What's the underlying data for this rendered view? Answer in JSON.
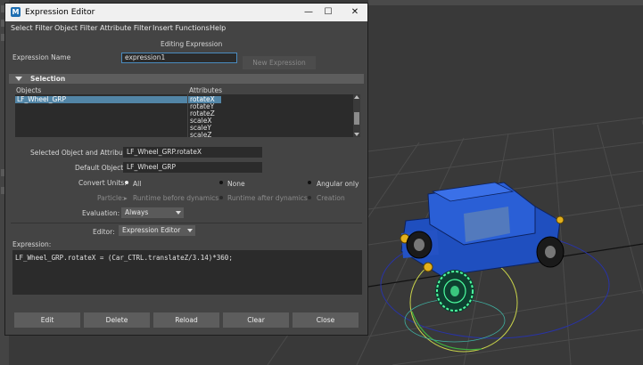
{
  "window": {
    "title": "Expression Editor",
    "icon_letter": "M",
    "controls": {
      "minimize": "—",
      "maximize": "☐",
      "close": "✕"
    }
  },
  "menu": [
    "Select Filter",
    "Object Filter",
    "Attribute Filter",
    "Insert Functions",
    "Help"
  ],
  "header": {
    "editing_label": "Editing Expression"
  },
  "expression_name": {
    "label": "Expression Name",
    "value": "expression1"
  },
  "new_expression_button": "New Expression",
  "selection": {
    "section_label": "Selection",
    "objects_label": "Objects",
    "attributes_label": "Attributes",
    "objects": [
      {
        "name": "LF_Wheel_GRP",
        "selected": true
      }
    ],
    "attributes": [
      {
        "name": "rotateX",
        "selected": true
      },
      {
        "name": "rotateY",
        "selected": false
      },
      {
        "name": "rotateZ",
        "selected": false
      },
      {
        "name": "scaleX",
        "selected": false
      },
      {
        "name": "scaleY",
        "selected": false
      },
      {
        "name": "scaleZ",
        "selected": false
      }
    ]
  },
  "selected_object_attribute": {
    "label": "Selected Object and Attribute:",
    "value": "LF_Wheel_GRP.rotateX"
  },
  "default_object": {
    "label": "Default Object:",
    "value": "LF_Wheel_GRP"
  },
  "convert_units": {
    "label": "Convert Units:",
    "options": [
      "All",
      "None",
      "Angular only"
    ],
    "selected": "All"
  },
  "particle": {
    "label": "Particle:",
    "options": [
      "Runtime before dynamics",
      "Runtime after dynamics",
      "Creation"
    ]
  },
  "evaluation": {
    "label": "Evaluation:",
    "value": "Always"
  },
  "editor": {
    "label": "Editor:",
    "value": "Expression Editor"
  },
  "expression": {
    "label": "Expression:",
    "text": "LF_Wheel_GRP.rotateX = (Car_CTRL.translateZ/3.14)*360;"
  },
  "buttons": [
    "Edit",
    "Delete",
    "Reload",
    "Clear",
    "Close"
  ],
  "colors": {
    "window_bg": "#444444",
    "selection_highlight": "#5285a6",
    "car_blue": "#1f4fbf",
    "wheel_select_green": "#4dffa0"
  }
}
